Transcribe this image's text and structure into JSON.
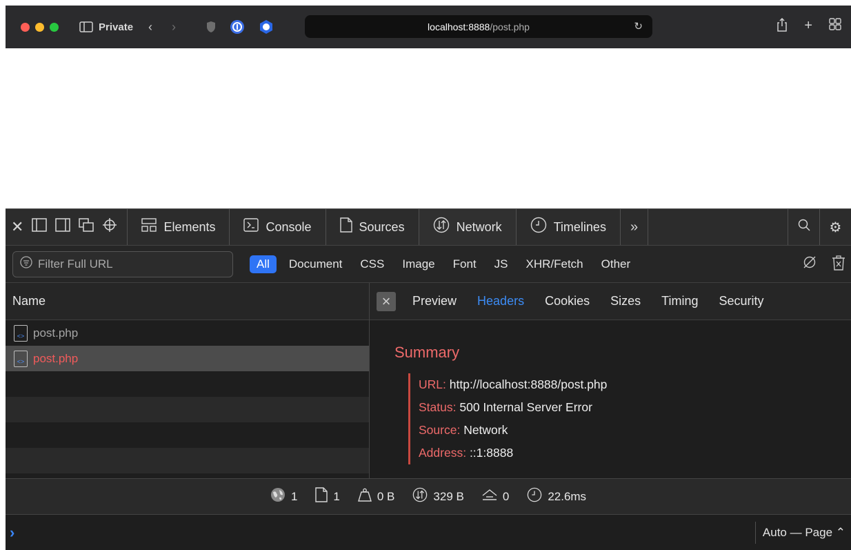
{
  "browser": {
    "private_label": "Private",
    "url_host": "localhost:8888",
    "url_path": "/post.php"
  },
  "devtools": {
    "tabs": [
      {
        "label": "Elements",
        "icon": "elements-icon"
      },
      {
        "label": "Console",
        "icon": "console-icon"
      },
      {
        "label": "Sources",
        "icon": "sources-icon"
      },
      {
        "label": "Network",
        "icon": "network-icon"
      },
      {
        "label": "Timelines",
        "icon": "timelines-icon"
      }
    ],
    "filter": {
      "placeholder": "Filter Full URL",
      "types": [
        "All",
        "Document",
        "CSS",
        "Image",
        "Font",
        "JS",
        "XHR/Fetch",
        "Other"
      ],
      "active_type": "All"
    },
    "list": {
      "column_header": "Name",
      "rows": [
        {
          "name": "post.php"
        },
        {
          "name": "post.php"
        }
      ]
    },
    "detail": {
      "tabs": [
        "Preview",
        "Headers",
        "Cookies",
        "Sizes",
        "Timing",
        "Security"
      ],
      "active_tab": "Headers",
      "summary_title": "Summary",
      "summary": {
        "url_key": "URL:",
        "url_value": "http://localhost:8888/post.php",
        "status_key": "Status:",
        "status_value": "500 Internal Server Error",
        "source_key": "Source:",
        "source_value": "Network",
        "address_key": "Address:",
        "address_value": "::1:8888"
      }
    },
    "status": {
      "domains": "1",
      "resources": "1",
      "transferred": "0 B",
      "size": "329 B",
      "redirects": "0",
      "time": "22.6ms"
    },
    "console": {
      "prompt": "›",
      "context": "Auto — Page ⌃"
    }
  },
  "colors": {
    "accent": "#2f74f5",
    "error": "#ee6a6a"
  }
}
